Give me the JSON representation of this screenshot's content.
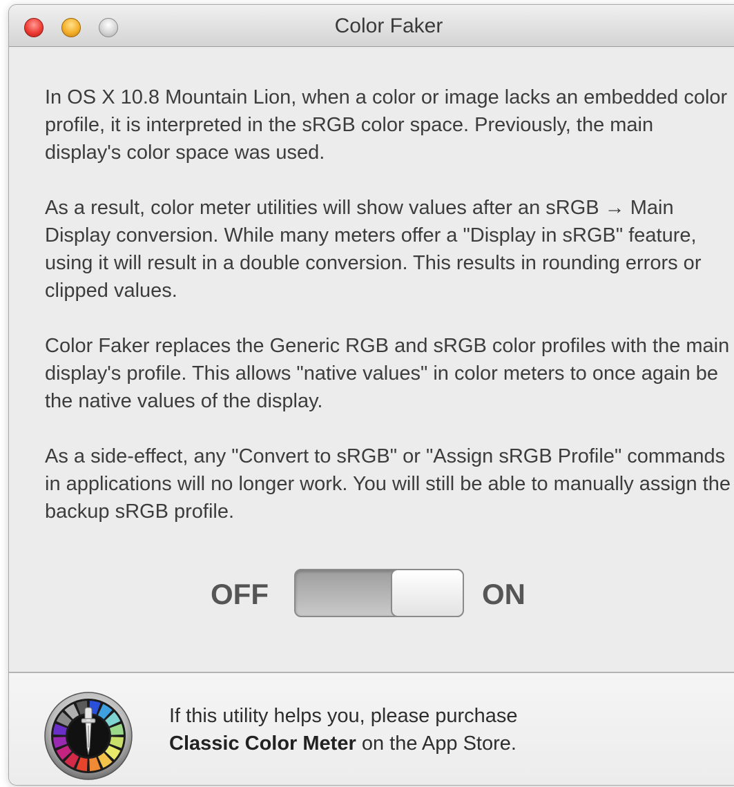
{
  "window": {
    "title": "Color Faker"
  },
  "paragraphs": [
    "In OS X 10.8 Mountain Lion, when a color or image lacks an embedded color profile, it is interpreted in  the sRGB color space. Previously, the main display's color space was used.",
    "As a result, color meter utilities will show values after an sRGB → Main Display conversion.  While many meters offer a \"Display in sRGB\" feature, using it will result in a double conversion.  This results in rounding errors or clipped values.",
    "Color Faker replaces the Generic RGB and sRGB color profiles with the main display's profile.  This allows \"native values\" in color meters to once again be the native values of the display.",
    "As a side-effect, any \"Convert to sRGB\" or \"Assign sRGB Profile\" commands in applications will no longer work.  You will still be able to manually assign the backup sRGB profile."
  ],
  "toggle": {
    "off_label": "OFF",
    "on_label": "ON",
    "state": "on"
  },
  "footer": {
    "line1": "If this utility helps you, please purchase",
    "app_name": "Classic Color Meter",
    "line2_suffix": " on the App Store.",
    "icon": "color-meter-icon"
  }
}
